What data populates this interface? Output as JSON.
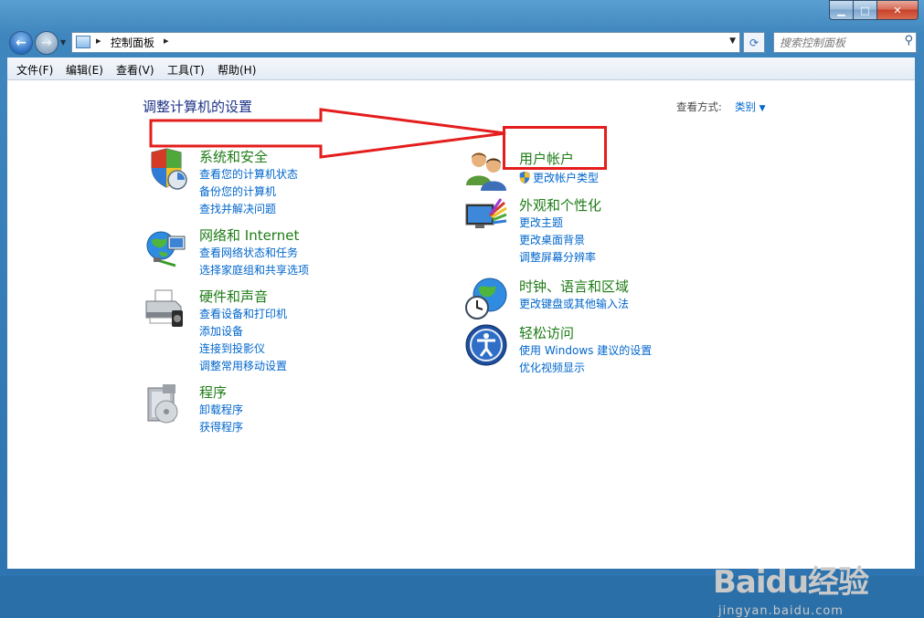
{
  "window": {
    "address": {
      "crumb": "控制面板"
    }
  },
  "search": {
    "placeholder": "搜索控制面板"
  },
  "menu": [
    "文件(F)",
    "编辑(E)",
    "查看(V)",
    "工具(T)",
    "帮助(H)"
  ],
  "page": {
    "title": "调整计算机的设置",
    "view_by_label": "查看方式:",
    "view_by_value": "类别"
  },
  "categories": {
    "system": {
      "title": "系统和安全",
      "links": [
        "查看您的计算机状态",
        "备份您的计算机",
        "查找并解决问题"
      ]
    },
    "network": {
      "title": "网络和 Internet",
      "links": [
        "查看网络状态和任务",
        "选择家庭组和共享选项"
      ]
    },
    "hardware": {
      "title": "硬件和声音",
      "links": [
        "查看设备和打印机",
        "添加设备",
        "连接到投影仪",
        "调整常用移动设置"
      ]
    },
    "programs": {
      "title": "程序",
      "links": [
        "卸载程序",
        "获得程序"
      ]
    },
    "users": {
      "title": "用户帐户",
      "links": [
        "更改帐户类型"
      ]
    },
    "appearance": {
      "title": "外观和个性化",
      "links": [
        "更改主题",
        "更改桌面背景",
        "调整屏幕分辨率"
      ]
    },
    "clock": {
      "title": "时钟、语言和区域",
      "links": [
        "更改键盘或其他输入法"
      ]
    },
    "ease": {
      "title": "轻松访问",
      "links": [
        "使用 Windows 建议的设置",
        "优化视频显示"
      ]
    }
  },
  "watermark": {
    "logo": "Baidu经验",
    "url": "jingyan.baidu.com"
  },
  "icons": {
    "back": "back-arrow-icon",
    "forward": "forward-arrow-icon",
    "refresh": "refresh-icon",
    "search": "magnifier-icon",
    "system": "shield-icon",
    "network": "globe-network-icon",
    "hardware": "printer-icon",
    "programs": "programs-box-icon",
    "users": "users-icon",
    "appearance": "monitor-palette-icon",
    "clock": "clock-globe-icon",
    "ease": "ease-of-access-icon",
    "uac": "uac-shield-icon"
  },
  "colors": {
    "link": "#0066cc",
    "category_title": "#1e7c16",
    "page_title": "#1e3287",
    "annotation": "#e41d1d"
  }
}
